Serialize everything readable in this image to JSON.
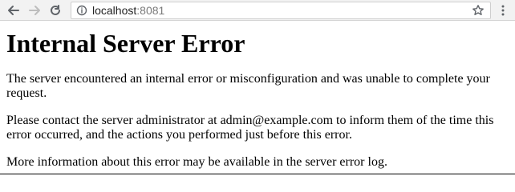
{
  "address_bar": {
    "host": "localhost",
    "port": ":8081"
  },
  "icons": {
    "back": "back-arrow-icon",
    "forward": "forward-arrow-icon",
    "reload": "reload-icon",
    "info": "info-icon",
    "bookmark": "star-icon",
    "menu": "kebab-menu-icon"
  },
  "page": {
    "heading": "Internal Server Error",
    "paragraphs": [
      "The server encountered an internal error or misconfiguration and was unable to complete your request.",
      "Please contact the server administrator at admin@example.com to inform them of the time this error occurred, and the actions you performed just before this error.",
      "More information about this error may be available in the server error log."
    ]
  }
}
